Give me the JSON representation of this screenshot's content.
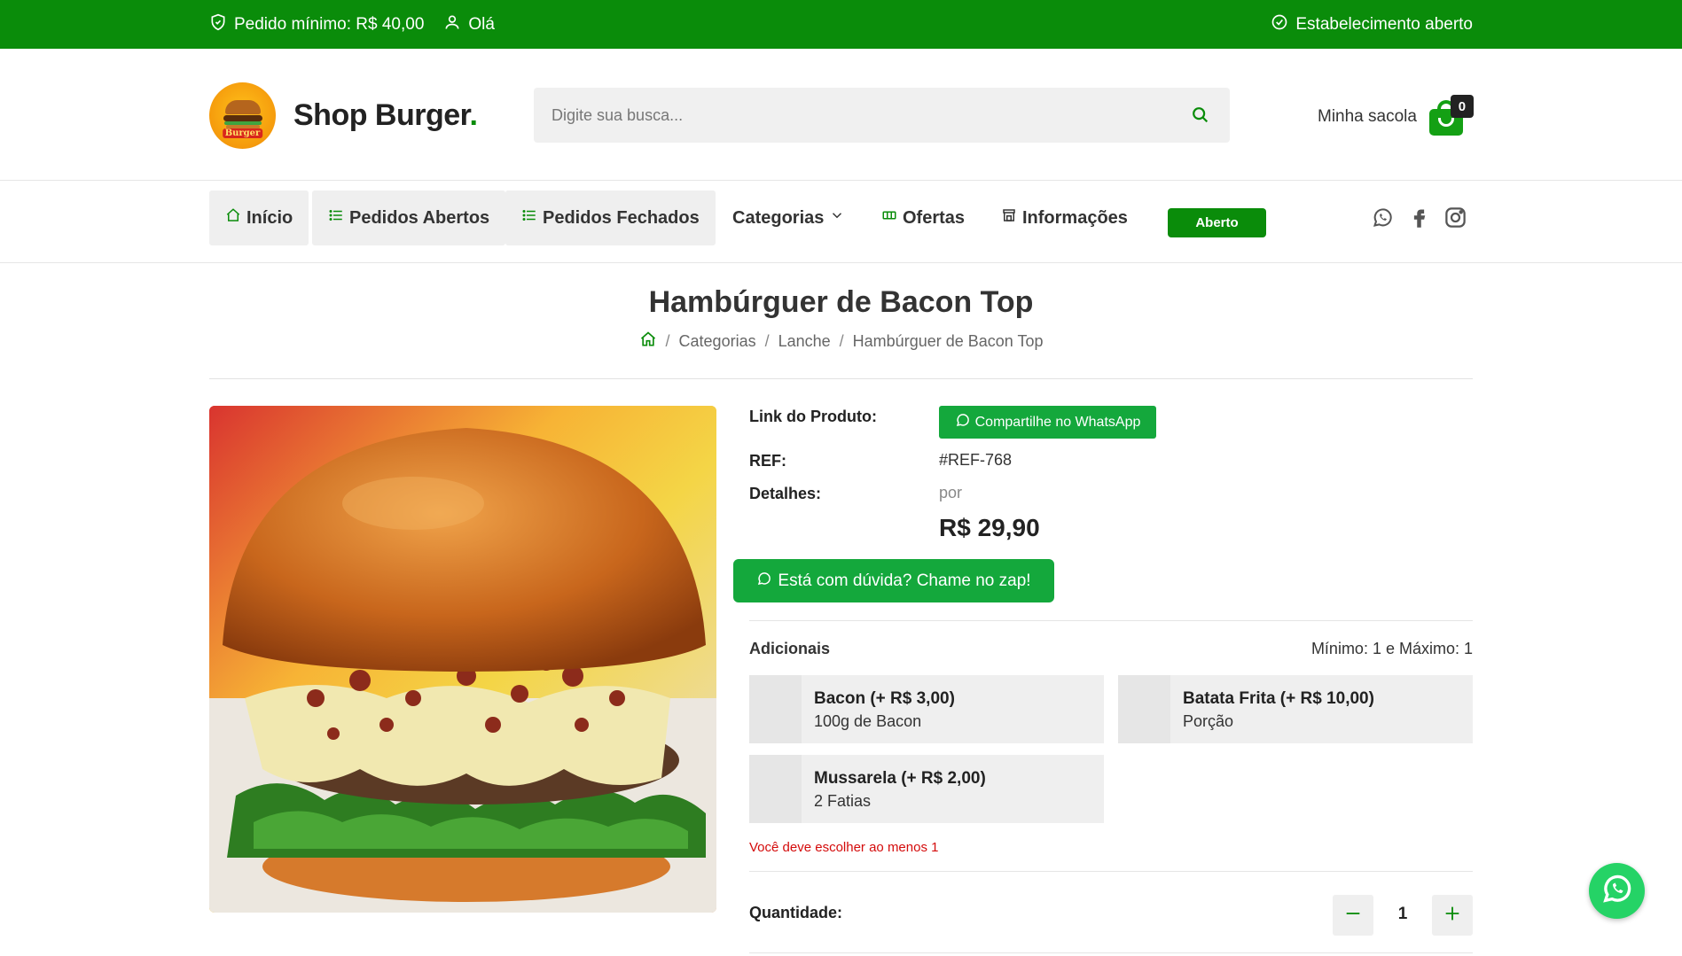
{
  "topbar": {
    "min_order": "Pedido mínimo: R$ 40,00",
    "greeting": "Olá",
    "status": "Estabelecimento aberto"
  },
  "header": {
    "logo_label": "Burger",
    "brand_name": "Shop Burger",
    "brand_dot": ".",
    "search_placeholder": "Digite sua busca...",
    "bag_label": "Minha sacola",
    "bag_count": "0"
  },
  "nav": {
    "items": [
      {
        "label": "Início"
      },
      {
        "label": "Pedidos Abertos"
      },
      {
        "label": "Pedidos Fechados"
      },
      {
        "label": "Categorias"
      },
      {
        "label": "Ofertas"
      },
      {
        "label": "Informações"
      }
    ],
    "status_badge": "Aberto"
  },
  "page": {
    "title": "Hambúrguer de Bacon Top",
    "breadcrumb": [
      "Categorias",
      "Lanche",
      "Hambúrguer de Bacon Top"
    ],
    "breadcrumb_sep": "/"
  },
  "product": {
    "link_label": "Link do Produto:",
    "share_label": "Compartilhe no WhatsApp",
    "ref_label": "REF:",
    "ref_value": "#REF-768",
    "details_label": "Detalhes:",
    "price_prefix": "por",
    "price": "R$ 29,90",
    "zap_label": "Está com dúvida? Chame no zap!"
  },
  "addons": {
    "title": "Adicionais",
    "rule": "Mínimo: 1 e Máximo: 1",
    "items": [
      {
        "name": "Bacon (+ R$ 3,00)",
        "desc": "100g de Bacon"
      },
      {
        "name": "Batata Frita (+ R$ 10,00)",
        "desc": "Porção"
      },
      {
        "name": "Mussarela (+ R$ 2,00)",
        "desc": "2 Fatias"
      }
    ],
    "warning": "Você deve escolher ao menos 1"
  },
  "quantity": {
    "label": "Quantidade:",
    "value": "1"
  },
  "colors": {
    "brand_green": "#0a8c0a",
    "button_green": "#14a83c",
    "warning_red": "#d40b0b"
  },
  "icons": [
    "shield-icon",
    "user-icon",
    "check-circle-icon",
    "search-icon",
    "bag-icon",
    "home-icon",
    "list-icon",
    "chevron-down-icon",
    "ticket-icon",
    "store-icon",
    "whatsapp-icon",
    "facebook-icon",
    "instagram-icon",
    "minus-icon",
    "plus-icon"
  ]
}
